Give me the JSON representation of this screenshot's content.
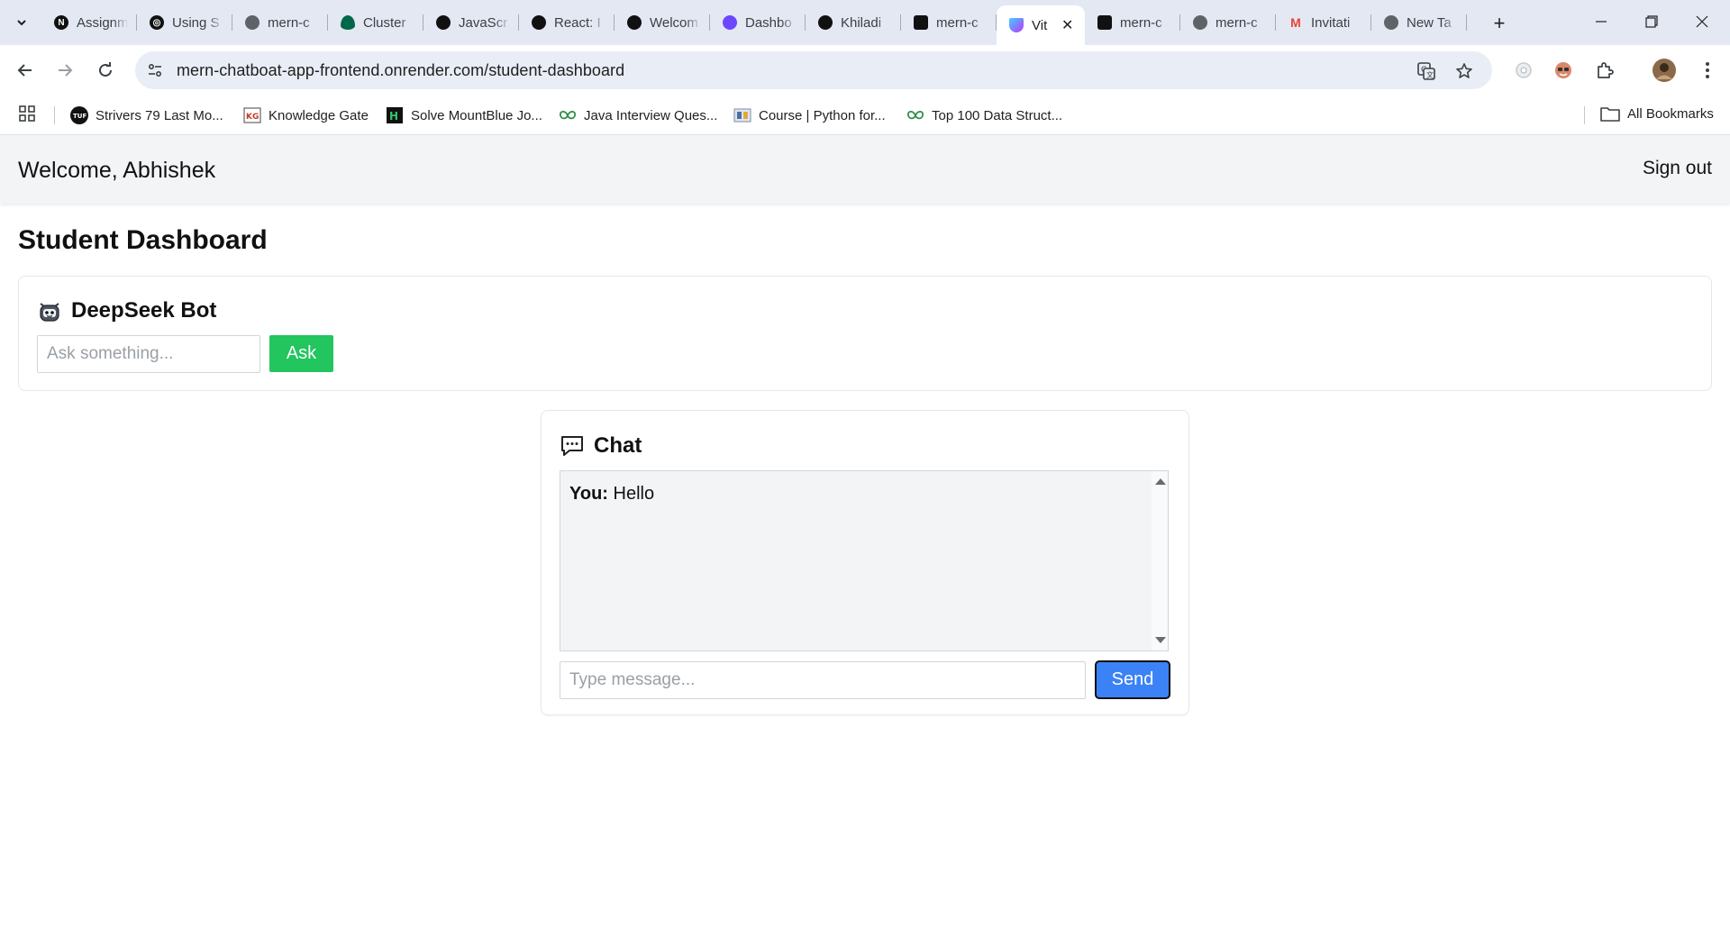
{
  "browser": {
    "tabs": [
      {
        "title": "Assignm",
        "favicon": "notion-icon",
        "color": "#111111",
        "glyph": "N"
      },
      {
        "title": "Using S",
        "favicon": "openai-icon",
        "color": "#111111",
        "glyph": "◎"
      },
      {
        "title": "mern-c",
        "favicon": "globe-icon",
        "color": "#5f6368",
        "glyph": ""
      },
      {
        "title": "Cluster",
        "favicon": "mongodb-leaf-icon",
        "color": "#00684a",
        "glyph": ""
      },
      {
        "title": "JavaScr",
        "favicon": "chatgpt-icon",
        "color": "#111111",
        "glyph": ""
      },
      {
        "title": "React: I",
        "favicon": "chatgpt-icon",
        "color": "#111111",
        "glyph": ""
      },
      {
        "title": "Welcom",
        "favicon": "chatgpt-icon",
        "color": "#111111",
        "glyph": ""
      },
      {
        "title": "Dashbo",
        "favicon": "clerk-icon",
        "color": "#6c47ff",
        "glyph": ""
      },
      {
        "title": "Khiladi",
        "favicon": "github-icon",
        "color": "#111111",
        "glyph": ""
      },
      {
        "title": "mern-c",
        "favicon": "render-icon",
        "color": "#111111",
        "glyph": ""
      },
      {
        "title": "Vit",
        "favicon": "vite-icon",
        "color": "#8e5cff",
        "glyph": "",
        "active": true
      },
      {
        "title": "mern-c",
        "favicon": "render-icon",
        "color": "#111111",
        "glyph": ""
      },
      {
        "title": "mern-c",
        "favicon": "globe-icon",
        "color": "#5f6368",
        "glyph": ""
      },
      {
        "title": "Invitati",
        "favicon": "gmail-icon",
        "color": "#ea4335",
        "glyph": "M"
      },
      {
        "title": "New Ta",
        "favicon": "chrome-icon",
        "color": "#5f6368",
        "glyph": ""
      }
    ],
    "url": "mern-chatboat-app-frontend.onrender.com/student-dashboard",
    "bookmarks": [
      {
        "label": "Strivers 79 Last Mo...",
        "favicon": "tuf-icon"
      },
      {
        "label": "Knowledge Gate",
        "favicon": "kg-icon"
      },
      {
        "label": "Solve MountBlue Jo...",
        "favicon": "hackerrank-icon"
      },
      {
        "label": "Java Interview Ques...",
        "favicon": "gfg-icon"
      },
      {
        "label": "Course | Python for...",
        "favicon": "course-icon"
      },
      {
        "label": "Top 100 Data Struct...",
        "favicon": "gfg-icon"
      }
    ],
    "all_bookmarks_label": "All Bookmarks"
  },
  "header": {
    "welcome": "Welcome, Abhishek",
    "signout": "Sign out"
  },
  "page_title": "Student Dashboard",
  "bot": {
    "title": "DeepSeek Bot",
    "placeholder": "Ask something...",
    "ask_label": "Ask"
  },
  "chat": {
    "title": "Chat",
    "messages": [
      {
        "sender": "You:",
        "text": "Hello"
      }
    ],
    "placeholder": "Type message...",
    "send_label": "Send"
  },
  "colors": {
    "ask_button": "#22c55e",
    "send_button": "#3b82f6",
    "header_bg": "#f3f4f6"
  }
}
